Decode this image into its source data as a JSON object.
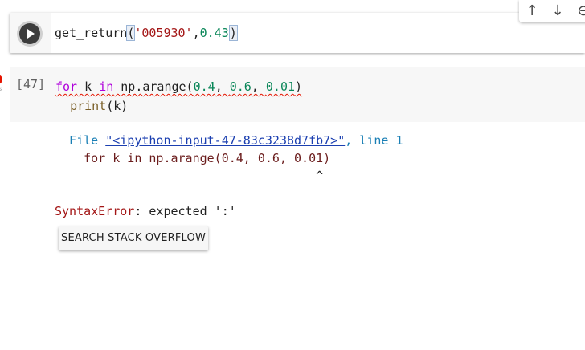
{
  "active_cell": {
    "code_fn": "get_return",
    "code_open": "(",
    "code_str": "'005930'",
    "code_comma": ",",
    "code_num": "0.43",
    "code_close": ")"
  },
  "toolbar": {
    "up_icon": "↑",
    "down_icon": "↓",
    "link_icon": "⊖"
  },
  "exec_cell": {
    "count": "[47]",
    "line1_kw": "for",
    "line1_mid": " k ",
    "line1_in": "in",
    "line1_np": " np.arange(",
    "line1_a": "0.4",
    "line1_sep1": ", ",
    "line1_b": "0.6",
    "line1_sep2": ", ",
    "line1_c": "0.01",
    "line1_end": ")",
    "line2_indent": "  ",
    "line2_fn": "print",
    "line2_arg": "(k)"
  },
  "output": {
    "file_label": "  File ",
    "file_link": "\"<ipython-input-47-83c3238d7fb7>\"",
    "file_line": ", line 1",
    "src_indent": "    ",
    "src_kw": "for",
    "src_rest": " k in np.arange(0.4, 0.6, 0.01)",
    "caret_line": "                                    ^",
    "err_name": "SyntaxError",
    "err_msg": ": expected ':'"
  },
  "search_button_label": "SEARCH STACK OVERFLOW",
  "colors": {
    "error_red": "#e51400",
    "cell_bg": "#f7f7f7"
  }
}
